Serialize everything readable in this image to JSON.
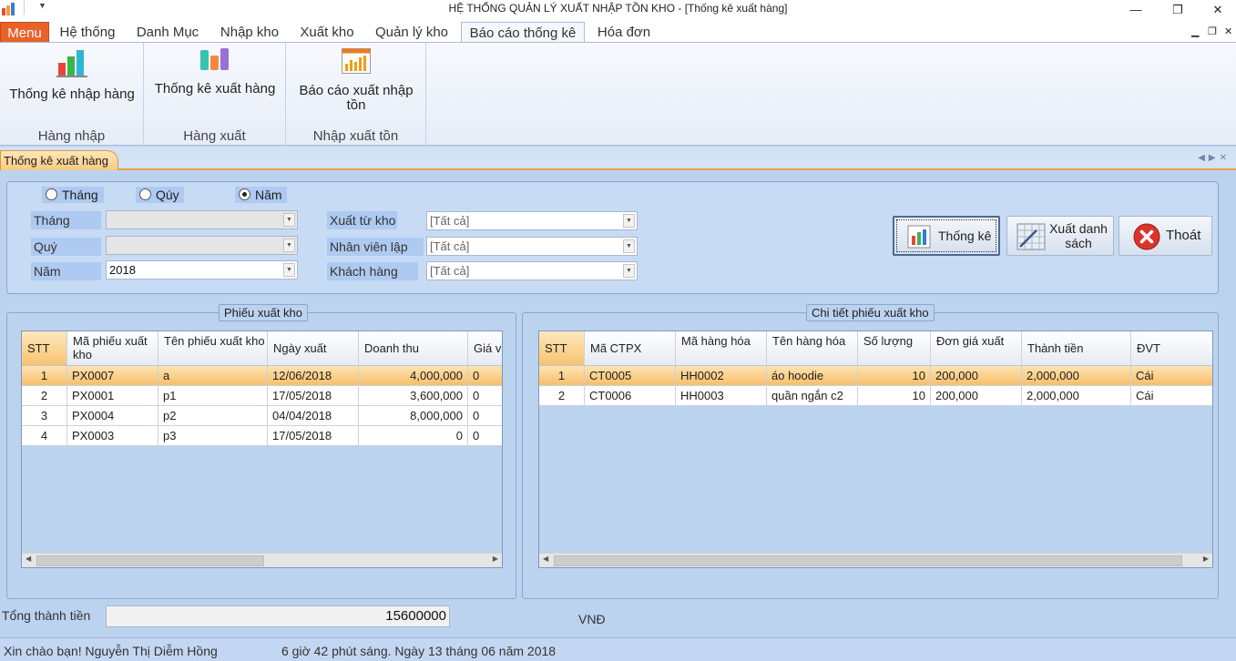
{
  "window": {
    "title": "HỆ THỐNG QUẢN LÝ XUẤT NHẬP TỒN KHO - [Thống kê xuất hàng]"
  },
  "ribbon_tabs": [
    {
      "label": "Menu"
    },
    {
      "label": "Hệ thống"
    },
    {
      "label": "Danh Mục"
    },
    {
      "label": "Nhập kho"
    },
    {
      "label": "Xuất kho"
    },
    {
      "label": "Quản lý kho"
    },
    {
      "label": "Báo cáo thống kê"
    },
    {
      "label": "Hóa đơn"
    }
  ],
  "ribbon": {
    "groups": [
      {
        "label": "Hàng nhập",
        "button": "Thống kê nhập hàng"
      },
      {
        "label": "Hàng xuất",
        "button": "Thống kê xuất hàng"
      },
      {
        "label": "Nhập xuất tồn",
        "button_line1": "Báo cáo xuất nhập",
        "button_line2": "tồn"
      }
    ]
  },
  "doc_tab": "Thống kê xuất hàng",
  "filter": {
    "radios": [
      {
        "label": "Tháng",
        "checked": false
      },
      {
        "label": "Qúy",
        "checked": false
      },
      {
        "label": "Năm",
        "checked": true
      }
    ],
    "labels": {
      "month": "Tháng",
      "quarter": "Quý",
      "year": "Năm",
      "warehouse": "Xuất từ kho",
      "employee": "Nhân viên lập",
      "customer": "Khách hàng"
    },
    "values": {
      "month": "",
      "quarter": "",
      "year": "2018",
      "warehouse": "[Tất cả]",
      "employee": "[Tất cả]",
      "customer": "[Tất cả]"
    }
  },
  "buttons": {
    "stats": "Thống kê",
    "export_line1": "Xuất danh",
    "export_line2": "sách",
    "exit": "Thoát"
  },
  "invoices": {
    "title": "Phiếu xuất kho",
    "headers": [
      "STT",
      "Mã phiếu xuất kho",
      "Tên phiếu xuất kho",
      "Ngày xuất",
      "Doanh thu",
      "Giá v"
    ],
    "rows": [
      [
        "1",
        "PX0007",
        "a",
        "12/06/2018",
        "4,000,000",
        "0"
      ],
      [
        "2",
        "PX0001",
        "p1",
        "17/05/2018",
        "3,600,000",
        "0"
      ],
      [
        "3",
        "PX0004",
        "p2",
        "04/04/2018",
        "8,000,000",
        "0"
      ],
      [
        "4",
        "PX0003",
        "p3",
        "17/05/2018",
        "0",
        "0"
      ]
    ]
  },
  "details": {
    "title": "Chi tiết phiếu xuất kho",
    "headers": [
      "STT",
      "Mã CTPX",
      "Mã hàng hóa",
      "Tên hàng hóa",
      "Số lượng",
      "Đơn giá xuất",
      "Thành tiền",
      "ĐVT"
    ],
    "rows": [
      [
        "1",
        "CT0005",
        "HH0002",
        "áo hoodie",
        "10",
        "200,000",
        "2,000,000",
        "Cái"
      ],
      [
        "2",
        "CT0006",
        "HH0003",
        "quần ngắn c2",
        "10",
        "200,000",
        "2,000,000",
        "Cái"
      ]
    ]
  },
  "total": {
    "label": "Tổng thành tiền",
    "value": "15600000",
    "unit": "VNĐ"
  },
  "status": {
    "greeting": "Xin chào bạn! Nguyễn Thị Diễm Hồng",
    "datetime": "6 giờ 42 phút sáng. Ngày 13 tháng 06 năm 2018"
  }
}
